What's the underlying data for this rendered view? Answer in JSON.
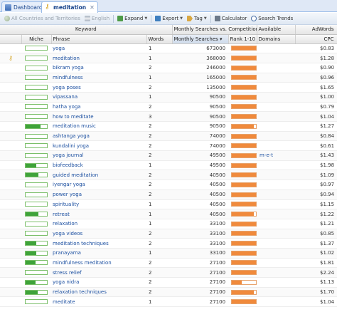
{
  "tabs": [
    {
      "label": "Dashboard",
      "icon": "dashboard-icon",
      "active": false
    },
    {
      "label": "meditation",
      "icon": "key-icon",
      "active": true,
      "close": "✕"
    }
  ],
  "toolbar": {
    "region": "All Countries and Territories",
    "language": "English",
    "expand": "Expand",
    "export": "Export",
    "tag": "Tag",
    "calculator": "Calculator",
    "search_trends": "Search Trends"
  },
  "header": {
    "keyword": "Keyword",
    "monthly_vs_comp": "Monthly Searches vs. Competition",
    "available": "Available",
    "adwords": "AdWords",
    "niche": "Niche",
    "phrase": "Phrase",
    "words": "Words",
    "monthly_searches": "Monthly Searches",
    "sort_arrow": "▾",
    "rank": "Rank 1-10",
    "domains": "Domains",
    "cpc": "CPC"
  },
  "colors": {
    "niche": "#3fa33a",
    "rank": "#f08a3c",
    "link": "#1b4fa0"
  },
  "rows": [
    {
      "key_icon": false,
      "niche": 0.0,
      "phrase": "yoga",
      "words": "1",
      "searches": "673000",
      "rank": 1.0,
      "domains": "",
      "cpc": "$0.83"
    },
    {
      "key_icon": true,
      "niche": 0.0,
      "phrase": "meditation",
      "words": "1",
      "searches": "368000",
      "rank": 1.0,
      "domains": "",
      "cpc": "$1.28"
    },
    {
      "key_icon": false,
      "niche": 0.0,
      "phrase": "bikram yoga",
      "words": "2",
      "searches": "246000",
      "rank": 1.0,
      "domains": "",
      "cpc": "$0.90"
    },
    {
      "key_icon": false,
      "niche": 0.0,
      "phrase": "mindfulness",
      "words": "1",
      "searches": "165000",
      "rank": 1.0,
      "domains": "",
      "cpc": "$0.96"
    },
    {
      "key_icon": false,
      "niche": 0.0,
      "phrase": "yoga poses",
      "words": "2",
      "searches": "135000",
      "rank": 1.0,
      "domains": "",
      "cpc": "$1.65"
    },
    {
      "key_icon": false,
      "niche": 0.0,
      "phrase": "vipassana",
      "words": "1",
      "searches": "90500",
      "rank": 1.0,
      "domains": "",
      "cpc": "$1.00"
    },
    {
      "key_icon": false,
      "niche": 0.0,
      "phrase": "hatha yoga",
      "words": "2",
      "searches": "90500",
      "rank": 1.0,
      "domains": "",
      "cpc": "$0.79"
    },
    {
      "key_icon": false,
      "niche": 0.0,
      "phrase": "how to meditate",
      "words": "3",
      "searches": "90500",
      "rank": 1.0,
      "domains": "",
      "cpc": "$1.04"
    },
    {
      "key_icon": false,
      "niche": 0.7,
      "phrase": "meditation music",
      "words": "2",
      "searches": "90500",
      "rank": 0.9,
      "domains": "",
      "cpc": "$1.27"
    },
    {
      "key_icon": false,
      "niche": 0.0,
      "phrase": "ashtanga yoga",
      "words": "2",
      "searches": "74000",
      "rank": 1.0,
      "domains": "",
      "cpc": "$0.84"
    },
    {
      "key_icon": false,
      "niche": 0.0,
      "phrase": "kundalini yoga",
      "words": "2",
      "searches": "74000",
      "rank": 1.0,
      "domains": "",
      "cpc": "$0.61"
    },
    {
      "key_icon": false,
      "niche": 0.0,
      "phrase": "yoga journal",
      "words": "2",
      "searches": "49500",
      "rank": 1.0,
      "domains": "m-e-t",
      "cpc": "$1.43"
    },
    {
      "key_icon": false,
      "niche": 0.5,
      "phrase": "biofeedback",
      "words": "1",
      "searches": "49500",
      "rank": 1.0,
      "domains": "",
      "cpc": "$1.98"
    },
    {
      "key_icon": false,
      "niche": 0.6,
      "phrase": "guided meditation",
      "words": "2",
      "searches": "40500",
      "rank": 1.0,
      "domains": "",
      "cpc": "$1.09"
    },
    {
      "key_icon": false,
      "niche": 0.0,
      "phrase": "iyengar yoga",
      "words": "2",
      "searches": "40500",
      "rank": 1.0,
      "domains": "",
      "cpc": "$0.97"
    },
    {
      "key_icon": false,
      "niche": 0.0,
      "phrase": "power yoga",
      "words": "2",
      "searches": "40500",
      "rank": 1.0,
      "domains": "",
      "cpc": "$0.94"
    },
    {
      "key_icon": false,
      "niche": 0.0,
      "phrase": "spirituality",
      "words": "1",
      "searches": "40500",
      "rank": 1.0,
      "domains": "",
      "cpc": "$1.15"
    },
    {
      "key_icon": false,
      "niche": 0.6,
      "phrase": "retreat",
      "words": "1",
      "searches": "40500",
      "rank": 0.9,
      "domains": "",
      "cpc": "$1.22"
    },
    {
      "key_icon": false,
      "niche": 0.0,
      "phrase": "relaxation",
      "words": "1",
      "searches": "33100",
      "rank": 1.0,
      "domains": "",
      "cpc": "$1.21"
    },
    {
      "key_icon": false,
      "niche": 0.0,
      "phrase": "yoga videos",
      "words": "2",
      "searches": "33100",
      "rank": 1.0,
      "domains": "",
      "cpc": "$0.85"
    },
    {
      "key_icon": false,
      "niche": 0.5,
      "phrase": "meditation techniques",
      "words": "2",
      "searches": "33100",
      "rank": 1.0,
      "domains": "",
      "cpc": "$1.37"
    },
    {
      "key_icon": false,
      "niche": 0.5,
      "phrase": "pranayama",
      "words": "1",
      "searches": "33100",
      "rank": 1.0,
      "domains": "",
      "cpc": "$1.02"
    },
    {
      "key_icon": false,
      "niche": 0.45,
      "phrase": "mindfulness meditation",
      "words": "2",
      "searches": "27100",
      "rank": 1.0,
      "domains": "",
      "cpc": "$1.81"
    },
    {
      "key_icon": false,
      "niche": 0.0,
      "phrase": "stress relief",
      "words": "2",
      "searches": "27100",
      "rank": 1.0,
      "domains": "",
      "cpc": "$2.24"
    },
    {
      "key_icon": false,
      "niche": 0.45,
      "phrase": "yoga nidra",
      "words": "2",
      "searches": "27100",
      "rank": 0.4,
      "domains": "",
      "cpc": "$1.13"
    },
    {
      "key_icon": false,
      "niche": 0.55,
      "phrase": "relaxation techniques",
      "words": "2",
      "searches": "27100",
      "rank": 0.9,
      "domains": "",
      "cpc": "$1.70"
    },
    {
      "key_icon": false,
      "niche": 0.0,
      "phrase": "meditate",
      "words": "1",
      "searches": "27100",
      "rank": 1.0,
      "domains": "",
      "cpc": "$1.04"
    }
  ]
}
